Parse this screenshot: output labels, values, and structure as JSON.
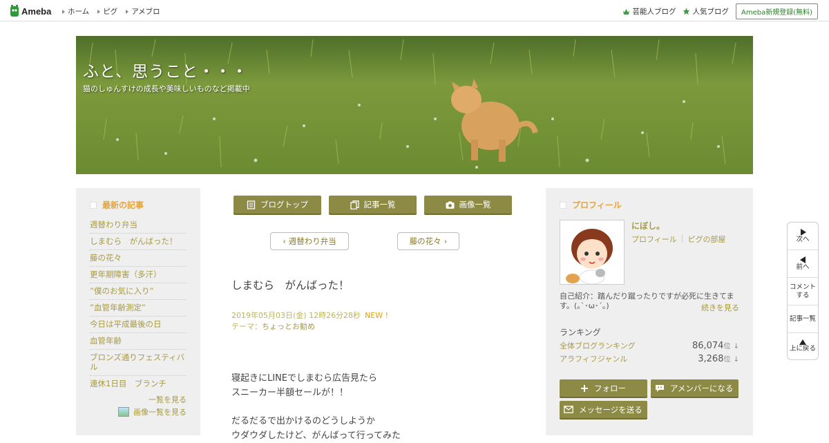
{
  "topbar": {
    "logo_text": "Ameba",
    "nav": [
      "ホーム",
      "ピグ",
      "アメブロ"
    ],
    "right_links": [
      "芸能人ブログ",
      "人気ブログ"
    ],
    "register_label": "Ameba新規登録(無料)"
  },
  "header": {
    "title": "ふと、思うこと・・・",
    "description": "猫のしゅんすけの成長や美味しいものなど掲載中"
  },
  "recent": {
    "heading": "最新の記事",
    "items": [
      "週替わり弁当",
      "しまむら　がんばった！",
      "藤の花々",
      "更年期障害（多汗）",
      "”僕のお気に入り”",
      "”血管年齢測定”",
      "今日は平成最後の日",
      "血管年齢",
      "ブロンズ通りフェスティバル",
      "連休1日目　ブランチ"
    ],
    "more_label": "一覧を見る",
    "image_list_label": "画像一覧を見る"
  },
  "main": {
    "buttons": [
      "ブログトップ",
      "記事一覧",
      "画像一覧"
    ],
    "prev_label": "週替わり弁当",
    "next_label": "藤の花々",
    "entry_title": "しまむら　がんばった！",
    "entry_date": "2019年05月03日(金) 12時26分28秒",
    "new_badge": "NEW !",
    "theme_label": "テーマ：",
    "theme_value": "ちょっとお勧め",
    "body": [
      "寝起きにLINEでしまむら広告見たら",
      "スニーカー半額セールが！！",
      "",
      "だるだるで出かけるのどうしようか",
      "ウダウダしたけど、がんばって行ってみた"
    ]
  },
  "profile": {
    "heading": "プロフィール",
    "name": "にぼし。",
    "links": [
      "プロフィール",
      "ピグの部屋"
    ],
    "intro": "自己紹介：踏んだり蹴ったりですが必死に生きてます。(｡`･ω･´｡)",
    "intro_more": "続きを見る",
    "ranking_heading": "ランキング",
    "rankings": [
      {
        "label": "全体ブログランキング",
        "value": "86,074",
        "unit": "位"
      },
      {
        "label": "アラフィフジャンル",
        "value": "3,268",
        "unit": "位"
      }
    ],
    "buttons": {
      "follow": "フォロー",
      "member": "アメンバーになる",
      "message": "メッセージを送る"
    }
  },
  "floatnav": [
    "次へ",
    "前へ",
    "コメントする",
    "記事一覧",
    "上に戻る"
  ],
  "colors": {
    "olive_button": "#8c8a45",
    "heading_orange": "#e7a53a",
    "link_olive": "#a79a43",
    "ameba_green": "#2d7d2a"
  }
}
